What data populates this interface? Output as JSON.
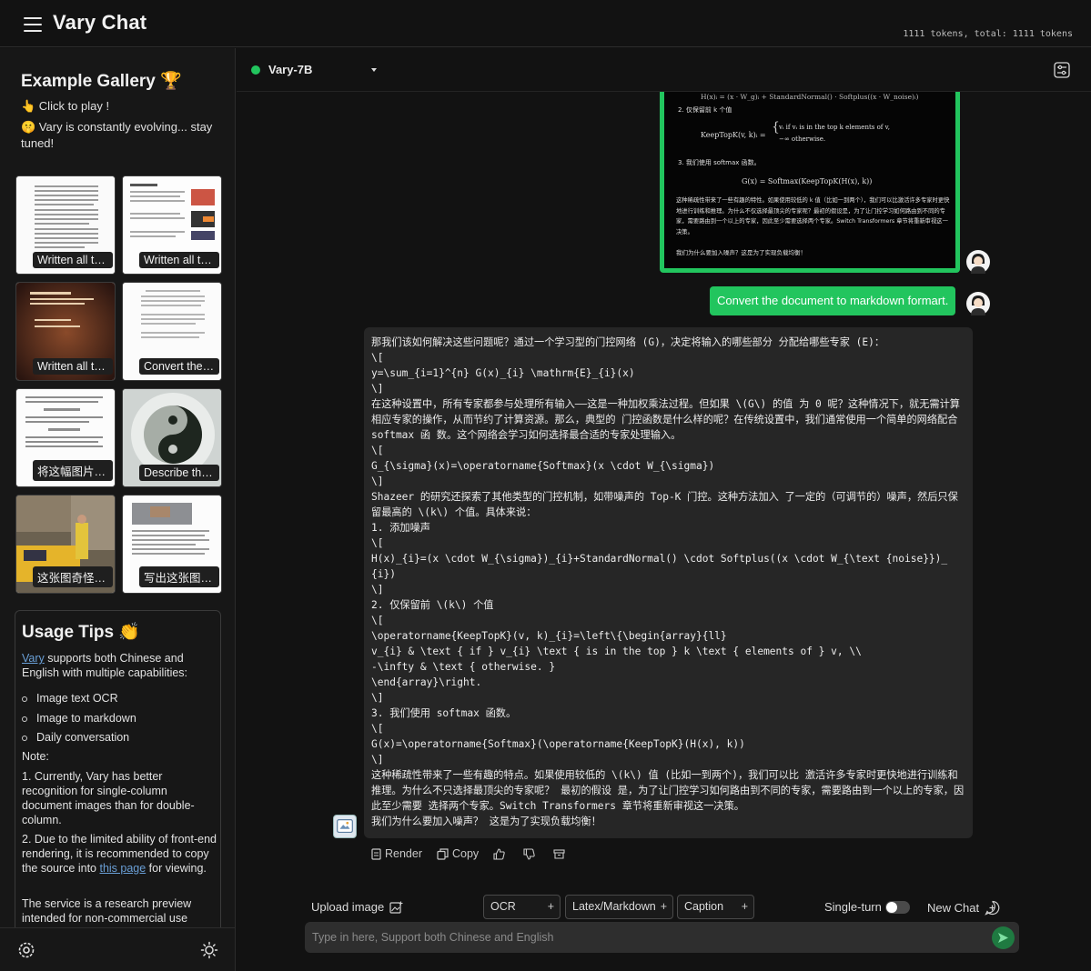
{
  "app": {
    "title": "Vary Chat",
    "token_count": "1111 tokens, total: 1111 tokens"
  },
  "sidebar": {
    "gallery_title": "Example Gallery 🏆",
    "click_to_play": "👆 Click to play !",
    "evolving": "🤫 Vary is constantly evolving... stay tuned!",
    "examples": [
      {
        "caption": "Written all the words in this image.",
        "kind": "paper"
      },
      {
        "caption": "Written all the words in this image.",
        "kind": "slides"
      },
      {
        "caption": "Written all the words in this image.",
        "kind": "dark-photo"
      },
      {
        "caption": "Convert the document to markdown format.",
        "kind": "document"
      },
      {
        "caption": "将这幅图片转换为markdown格式",
        "kind": "formula-doc"
      },
      {
        "caption": "Describe this image in detail.",
        "kind": "yin-yang"
      },
      {
        "caption": "这张图奇怪在哪里？",
        "kind": "taxi-street"
      },
      {
        "caption": "写出这张图所有文字",
        "kind": "chinese-doc"
      }
    ],
    "tips": {
      "title": "Usage Tips 👏",
      "intro_link": "Vary",
      "intro_rest": " supports both Chinese and English with multiple capabilities:",
      "capabilities": [
        "Image text OCR",
        "Image to markdown",
        "Daily conversation"
      ],
      "note_label": "Note:",
      "note1": "1. Currently, Vary has better recognition for single-column document images than for double-column.",
      "note2_a": "2. Due to the limited ability of front-end rendering, it is recommended to copy the source into ",
      "note2_link": "this page",
      "note2_b": " for viewing.",
      "service": "The service is a research preview intended for non-commercial use"
    },
    "footer_icons": [
      "settings-icon",
      "theme-sun-icon"
    ]
  },
  "chat": {
    "model_name": "Vary-7B",
    "status_color": "#22c55e",
    "image_doc": {
      "formula_top": "H(x)ᵢ = (x · W_g)ᵢ + StandardNormal() · Softplus((x · W_noise)ᵢ)",
      "step2": "2. 仅保留前 k 个值",
      "keeptopk_left": "KeepTopK(v, k)ᵢ =",
      "keeptopk_case1": "vᵢ     if vᵢ is in the top k elements of v,",
      "keeptopk_case2": "−∞    otherwise.",
      "step3": "3. 我们使用 softmax 函数。",
      "gx": "G(x) = Softmax(KeepTopK(H(x), k))",
      "para": "这种稀疏性带来了一些有趣的特性。如果使用较低的 k 值（比如一到两个），我们可以比激活许多专家时更快地进行训练和推理。为什么不仅选择最顶尖的专家呢？最初的假设是，为了让门控学习如何路由到不同的专家，需要路由到一个以上的专家，因此至少需要选择两个专家。Switch Transformers 章节将重新审视这一决策。",
      "last": "我们为什么要加入噪声？这是为了实现负载均衡！"
    },
    "user_message": "Convert the document to markdown formart.",
    "bot_message": "那我们该如何解决这些问题呢？通过一个学习型的门控网络 (G)，决定将输入的哪些部分 分配给哪些专家 (E)：\n\\[\ny=\\sum_{i=1}^{n} G(x)_{i} \\mathrm{E}_{i}(x)\n\\]\n在这种设置中，所有专家都参与处理所有输入——这是一种加权乘法过程。但如果 \\(G\\) 的值 为 0 呢？这种情况下，就无需计算相应专家的操作，从而节约了计算资源。那么，典型的 门控函数是什么样的呢？在传统设置中，我们通常使用一个简单的网络配合 softmax 函 数。这个网络会学习如何选择最合适的专家处理输入。\n\\[\nG_{\\sigma}(x)=\\operatorname{Softmax}(x \\cdot W_{\\sigma})\n\\]\nShazeer 的研究还探索了其他类型的门控机制，如带噪声的 Top-K 门控。这种方法加入 了一定的（可调节的）噪声，然后只保留最高的 \\(k\\) 个值。具体来说：\n1. 添加噪声\n\\[\nH(x)_{i}=(x \\cdot W_{\\sigma})_{i}+StandardNormal() \\cdot Softplus((x \\cdot W_{\\text {noise}})_{i})\n\\]\n2. 仅保留前 \\(k\\) 个值\n\\[\n\\operatorname{KeepTopK}(v, k)_{i}=\\left\\{\\begin{array}{ll}\nv_{i} & \\text { if } v_{i} \\text { is in the top } k \\text { elements of } v, \\\\\n-\\infty & \\text { otherwise. }\n\\end{array}\\right.\n\\]\n3. 我们使用 softmax 函数。\n\\[\nG(x)=\\operatorname{Softmax}(\\operatorname{KeepTopK}(H(x), k))\n\\]\n这种稀疏性带来了一些有趣的特点。如果使用较低的 \\(k\\) 值 (比如一到两个)，我们可以比 激活许多专家时更快地进行训练和推理。为什么不只选择最顶尖的专家呢？ 最初的假设 是，为了让门控学习如何路由到不同的专家，需要路由到一个以上的专家，因此至少需要 选择两个专家。Switch Transformers 章节将重新审视这一决策。\n我们为什么要加入噪声？ 这是为了实现负载均衡！",
    "actions": {
      "render": "Render",
      "copy": "Copy"
    }
  },
  "controls": {
    "upload_label": "Upload image",
    "chips": [
      "OCR",
      "Latex/Markdown",
      "Caption"
    ],
    "single_turn_label": "Single-turn",
    "single_turn_on": false,
    "new_chat_label": "New Chat",
    "input_placeholder": "Type in here, Support both Chinese and English",
    "accent": "#22c55e"
  }
}
